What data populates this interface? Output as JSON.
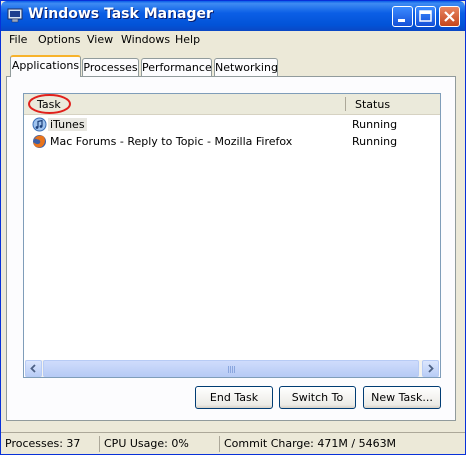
{
  "window": {
    "title": "Windows Task Manager"
  },
  "menu": [
    "File",
    "Options",
    "View",
    "Windows",
    "Help"
  ],
  "tabs": [
    "Applications",
    "Processes",
    "Performance",
    "Networking"
  ],
  "list": {
    "columns": [
      "Task",
      "Status"
    ],
    "rows": [
      {
        "icon": "itunes-icon",
        "name": "iTunes",
        "status": "Running"
      },
      {
        "icon": "firefox-icon",
        "name": "Mac Forums - Reply to Topic - Mozilla Firefox",
        "status": "Running"
      }
    ]
  },
  "buttons": {
    "end_task": "End Task",
    "switch_to": "Switch To",
    "new_task": "New Task..."
  },
  "status": {
    "processes": "Processes: 37",
    "cpu": "CPU Usage: 0%",
    "commit": "Commit Charge: 471M / 5463M"
  },
  "colors": {
    "titlebar": "#0253d7",
    "highlight_circle": "#e0201b",
    "active_tab": "#f7b32c"
  }
}
